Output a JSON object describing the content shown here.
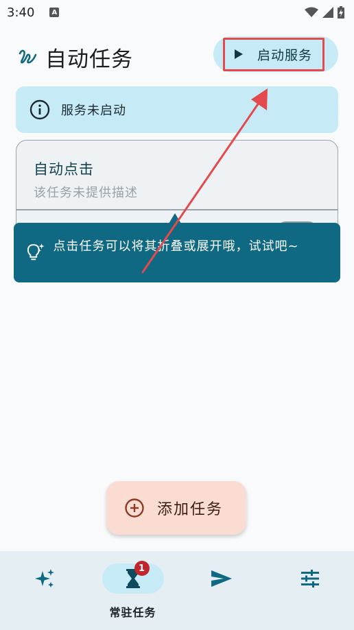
{
  "status_bar": {
    "time": "3:40",
    "notification_icon": "A"
  },
  "header": {
    "title": "自动任务",
    "start_button_label": "启动服务"
  },
  "service_banner": {
    "text": "服务未启动"
  },
  "task_card": {
    "title": "自动点击",
    "description": "该任务未提供描述"
  },
  "tooltip": {
    "text": "点击任务可以将其折叠或展开哦，试试吧~"
  },
  "fab": {
    "label": "添加任务"
  },
  "bottom_nav": {
    "items": [
      {
        "icon": "sparkle-icon",
        "label": ""
      },
      {
        "icon": "hourglass-icon",
        "label": "常驻任务",
        "badge": "1",
        "active": true
      },
      {
        "icon": "send-icon",
        "label": ""
      },
      {
        "icon": "tune-icon",
        "label": ""
      }
    ]
  },
  "colors": {
    "accent": "#0f6983",
    "banner_bg": "#c6ebf7",
    "fab_bg": "#fadcd2",
    "highlight": "#e34a4d"
  }
}
